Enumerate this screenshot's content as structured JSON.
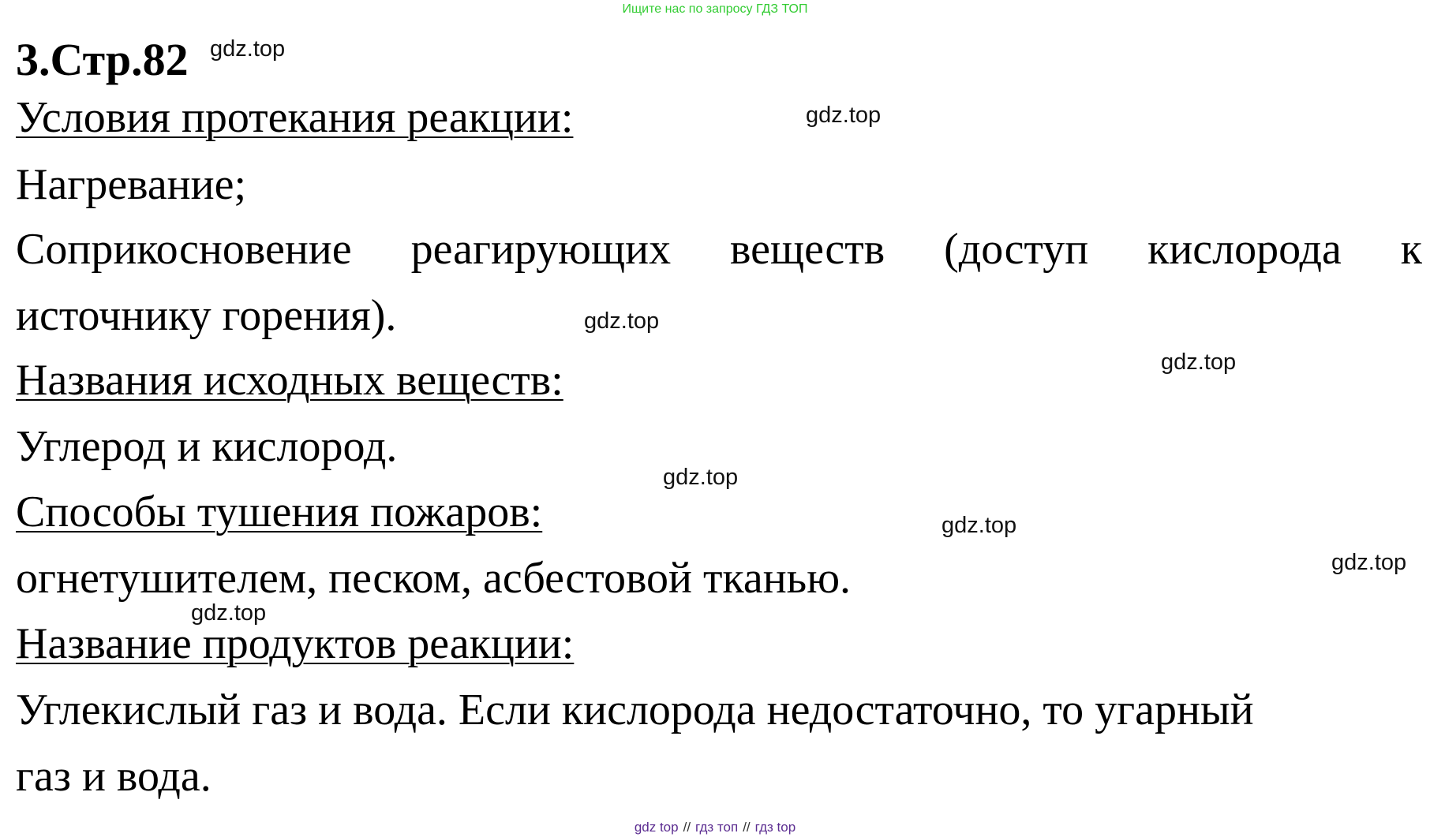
{
  "banner": "Ищите нас по запросу ГДЗ ТОП",
  "title": "3.Стр.82",
  "watermark": "gdz.top",
  "sections": {
    "conditions_heading": "Условия протекания реакции:",
    "conditions_line1": "Нагревание;",
    "conditions_line2_words": [
      "Соприкосновение",
      "реагирующих",
      "веществ",
      "(доступ",
      "кислорода",
      "к"
    ],
    "conditions_line3": "источнику горения).",
    "reactants_heading": "Названия исходных веществ:",
    "reactants_text": "Углерод и кислород.",
    "extinguish_heading": "Способы тушения пожаров:",
    "extinguish_text": "огнетушителем, песком, асбестовой тканью.",
    "products_heading": "Название продуктов реакции:",
    "products_line1": "Углекислый газ и вода. Если кислорода недостаточно, то угарный",
    "products_line2": "газ и вода."
  },
  "footer_links": [
    "gdz top",
    "гдз топ",
    "гдз top"
  ],
  "footer_separator": "//",
  "colors": {
    "banner": "#33cc33",
    "footer_links": "#5c2d91",
    "text": "#000000"
  }
}
